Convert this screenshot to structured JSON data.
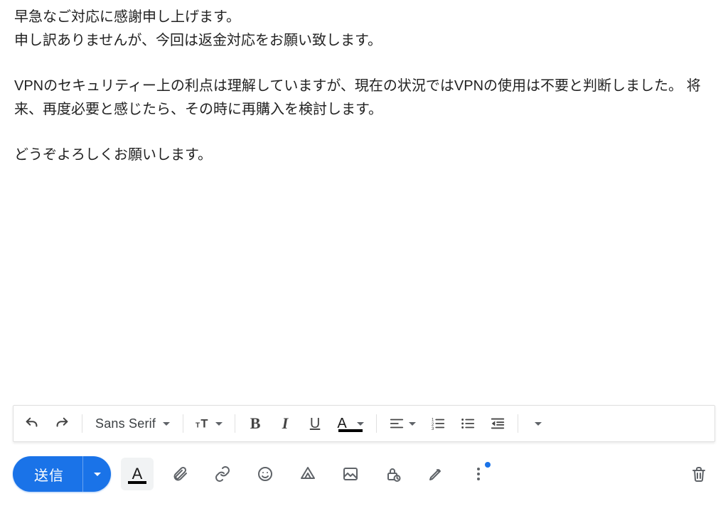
{
  "body": {
    "p1": "早急なご対応に感謝申し上げます。",
    "p2": "申し訳ありませんが、今回は返金対応をお願い致します。",
    "p3": " VPNのセキュリティー上の利点は理解していますが、現在の状況ではVPNの使用は不要と判断しました。 将来、再度必要と感じたら、その時に再購入を検討します。",
    "p4": "どうぞよろしくお願いします。"
  },
  "format_toolbar": {
    "font_name": "Sans Serif"
  },
  "send_row": {
    "send_label": "送信"
  },
  "colors": {
    "primary": "#1a73e8",
    "icon": "#5f6368"
  }
}
